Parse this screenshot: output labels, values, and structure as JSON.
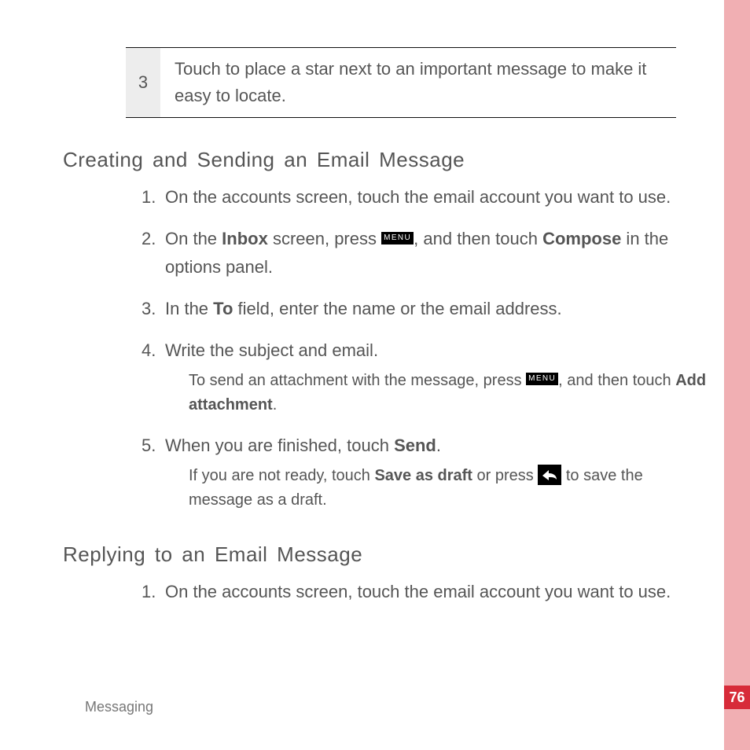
{
  "table_row": {
    "number": "3",
    "text": "Touch to place a star next to an important message to make it easy to locate."
  },
  "section1": {
    "heading": "Creating and Sending an Email Message",
    "steps": {
      "s1": {
        "num": "1.",
        "text": "On the accounts screen, touch the email account you want to use."
      },
      "s2": {
        "num": "2.",
        "p1": "On the ",
        "b1": "Inbox",
        "p2": " screen, press ",
        "p3": ", and then touch ",
        "b2": "Compose",
        "p4": " in the options panel."
      },
      "s3": {
        "num": "3.",
        "p1": "In the ",
        "b1": "To",
        "p2": " field, enter the name or the email address."
      },
      "s4": {
        "num": "4.",
        "text": "Write the subject and email.",
        "note_p1": "To send an attachment with the message,  press ",
        "note_p2": ", and then touch ",
        "note_b1": "Add attachment",
        "note_p3": "."
      },
      "s5": {
        "num": "5.",
        "p1": "When you are finished, touch ",
        "b1": "Send",
        "p2": ".",
        "note_p1": "If you are not ready, touch ",
        "note_b1": "Save as draft",
        "note_p2": " or press ",
        "note_p3": " to save the message as a draft."
      }
    }
  },
  "section2": {
    "heading": "Replying to an Email Message",
    "steps": {
      "s1": {
        "num": "1.",
        "text": "On the accounts screen, touch the email account you want to use."
      }
    }
  },
  "menu_label": "MENU",
  "footer": "Messaging",
  "page_number": "76"
}
